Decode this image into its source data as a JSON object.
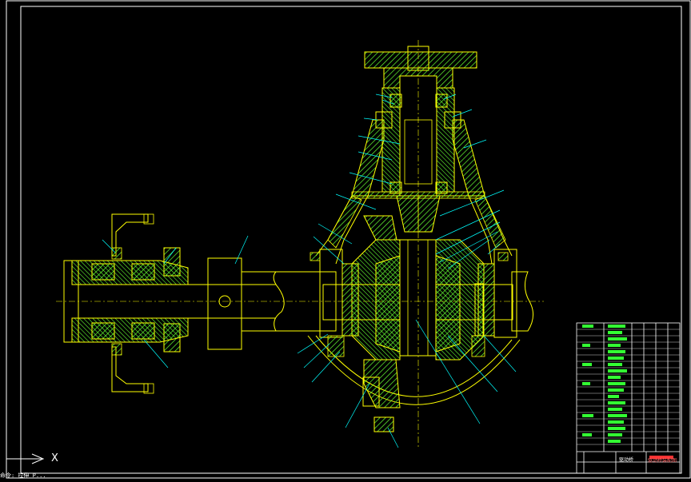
{
  "viewport": {
    "background": "#000000",
    "line_color": "#ffff00",
    "hatch_color": "#66ff33",
    "leader_color": "#00ffff",
    "border_color": "#ffffff"
  },
  "ucs": {
    "axis_label": "X",
    "icon": "ucs-arrow-icon"
  },
  "title_block": {
    "drawing_name": "驱动桥装配图",
    "label_left": "驱动桥"
  },
  "command_line": {
    "text": "命令: 拉伸 P..."
  }
}
